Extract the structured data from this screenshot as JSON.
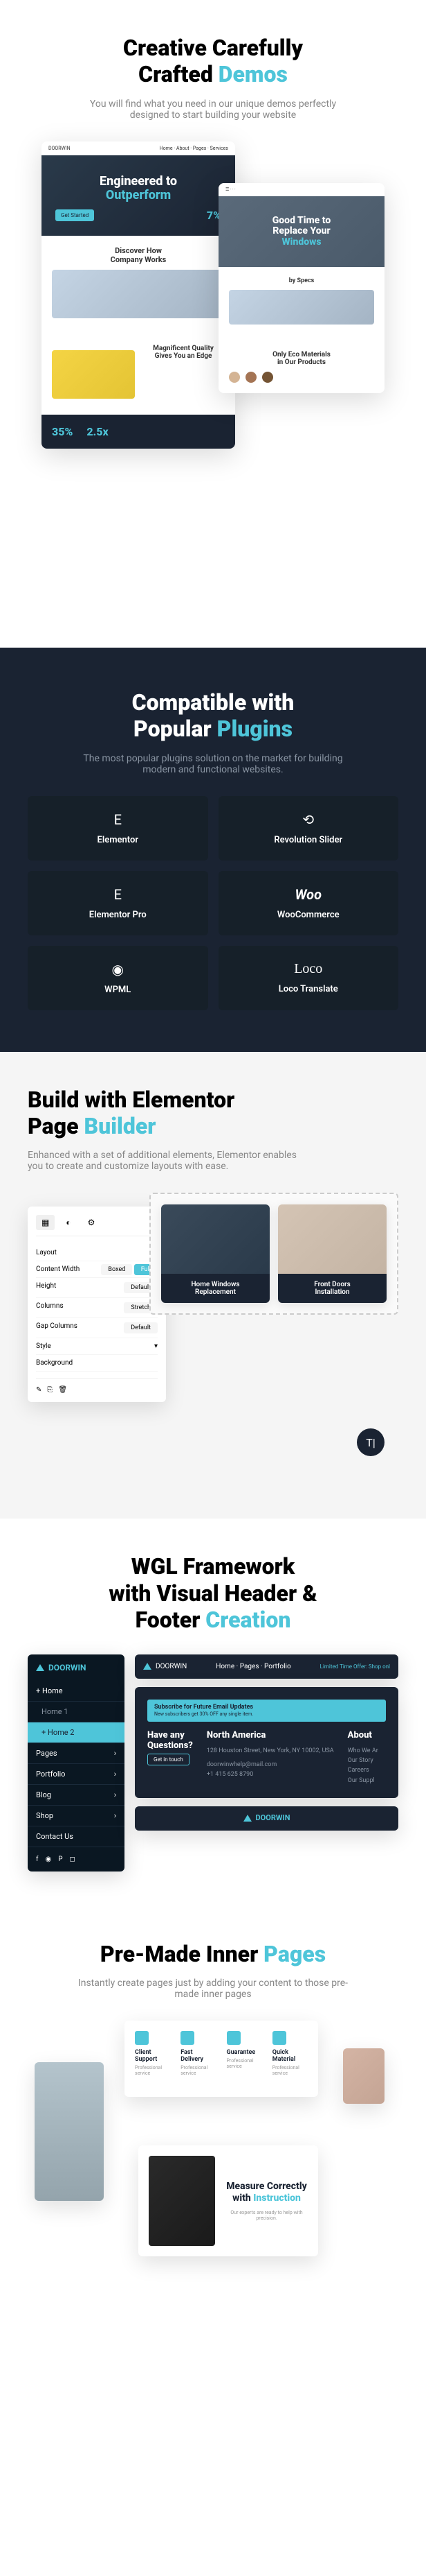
{
  "s1": {
    "title1": "Creative Carefully",
    "title2": "Crafted ",
    "title3": "Demos",
    "desc": "You will find what you need in our unique demos perfectly designed to start building your website",
    "demo1": {
      "brand": "DOORWIN",
      "nav": "Home · About · Pages · Services",
      "headline1": "Engineered to",
      "headline2": "Outperform",
      "cta": "Get Started",
      "stat1": "7%",
      "section1": "Discover How",
      "section2": "Company Works",
      "section3": "Magnificent Quality",
      "section4": "Gives You an Edge",
      "stat2": "35%",
      "stat3": "2.5x"
    },
    "demo2": {
      "headline1": "Good Time to",
      "headline2": "Replace Your",
      "headline3": "Windows",
      "section1": "by Specs",
      "section2": "Only Eco Materials",
      "section3": "in Our Products"
    }
  },
  "s2": {
    "title1": "Compatible with",
    "title2": "Popular ",
    "title3": "Plugins",
    "desc": "The most popular plugins solution on the market for building modern and functional websites.",
    "plugins": [
      "Elementor",
      "Revolution Slider",
      "Elementor Pro",
      "WooCommerce",
      "WPML",
      "Loco Translate"
    ]
  },
  "s3": {
    "title1": "Build with Elementor",
    "title2": "Page ",
    "title3": "Builder",
    "desc": "Enhanced with a set of additional elements, Elementor enables you to create and customize layouts with ease.",
    "panel": {
      "layout": "Layout",
      "cw": "Content Width",
      "boxed": "Boxed",
      "full": "Full",
      "height": "Height",
      "def": "Default",
      "cols": "Columns",
      "str": "Stretch",
      "gap": "Gap Columns",
      "style": "Style",
      "bg": "Background"
    },
    "preview": {
      "card1a": "Home Windows",
      "card1b": "Replacement",
      "card2a": "Front Doors",
      "card2b": "Installation"
    }
  },
  "s4": {
    "title1": "WGL Framework",
    "title2": "with Visual Header &",
    "title3": "Footer ",
    "title4": "Creation",
    "sidebar": {
      "brand": "DOORWIN",
      "items": [
        "+ Home",
        "Home 1",
        "+ Home 2",
        "Pages",
        "Portfolio",
        "Blog",
        "Shop",
        "Contact Us"
      ]
    },
    "header": {
      "brand": "DOORWIN",
      "nav": "Home · Pages · Portfolio",
      "promo": "Limited Time Offer: Shop onl"
    },
    "footer": {
      "sub": "Subscribe for Future Email Updates",
      "sub2": "New subscribers get 30% OFF any single item.",
      "col1t": "Have any",
      "col1t2": "Questions?",
      "col1b": "Get in touch",
      "col2t": "North America",
      "col2a": "128 Houston Street,\nNew York, NY 10002, USA",
      "col2e": "doorwinwhelp@mail.com",
      "col2p": "+1 415 625 8790",
      "col3t": "About",
      "col3a": "Who We Ar\nOur Story\nCareers\nOur Suppl"
    },
    "bottom": "DOORWIN"
  },
  "s5": {
    "title1": "Pre-Made Inner ",
    "title2": "Pages",
    "desc": "Instantly create pages just by adding your content to those pre-made inner pages",
    "features": [
      "Client Support",
      "Fast Delivery",
      "Guarantee",
      "Quick Material"
    ],
    "fdesc": "Professional service",
    "measure1": "Measure Correctly",
    "measure2": "with ",
    "measure3": "Instruction",
    "mdesc": "Our experts are ready to help with precision."
  }
}
